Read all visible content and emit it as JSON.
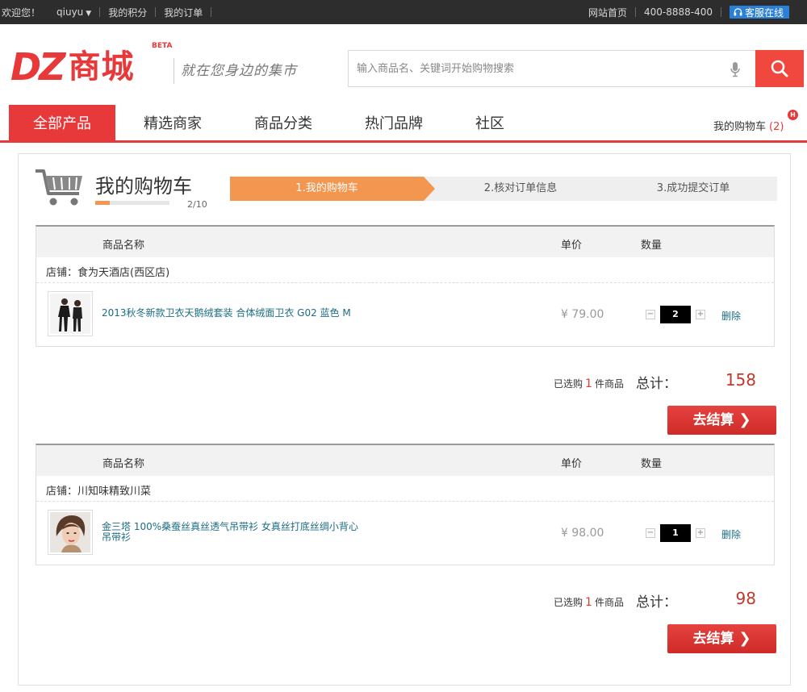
{
  "topbar": {
    "welcome": "欢迎您！",
    "username": "qiuyu",
    "points": "我的积分",
    "orders": "我的订单",
    "home": "网站首页",
    "phone": "400-8888-400",
    "service": "客服在线"
  },
  "header": {
    "logo_latin": "DZ",
    "logo_cn": "商城",
    "beta": "BETA",
    "slogan": "就在您身边的集市",
    "search_placeholder": "输入商品名、关键词开始购物搜索"
  },
  "nav": {
    "items": [
      "全部产品",
      "精选商家",
      "商品分类",
      "热门品牌",
      "社区"
    ],
    "cart_label": "我的购物车",
    "cart_count": "(2)",
    "cart_badge": "H"
  },
  "cart": {
    "title": "我的购物车",
    "progress": 0.2,
    "progress_text": "2/10",
    "steps": [
      "1.我的购物车",
      "2.核对订单信息",
      "3.成功提交订单"
    ],
    "columns": {
      "name": "商品名称",
      "price": "单价",
      "qty": "数量"
    },
    "stores": [
      {
        "shop": "店铺：食为天酒店(西区店)",
        "item_name": "2013秋冬新款卫衣天鹅绒套装 合体绒面卫衣 G02 蓝色 M",
        "price": "¥ 79.00",
        "qty": "2",
        "delete": "删除",
        "selected_prefix": "已选购",
        "selected_count": "1",
        "selected_suffix": "件商品",
        "total_label": "总计：",
        "total": "158",
        "checkout": "去结算"
      },
      {
        "shop": "店铺：川知味精致川菜",
        "item_name": "金三塔 100%桑蚕丝真丝透气吊带衫 女真丝打底丝绸小背心吊带衫",
        "price": "¥ 98.00",
        "qty": "1",
        "delete": "删除",
        "selected_prefix": "已选购",
        "selected_count": "1",
        "selected_suffix": "件商品",
        "total_label": "总计：",
        "total": "98",
        "checkout": "去结算"
      }
    ]
  },
  "colors": {
    "brand": "#e8393a",
    "step_active": "#f29650",
    "link": "#1b6d85"
  }
}
